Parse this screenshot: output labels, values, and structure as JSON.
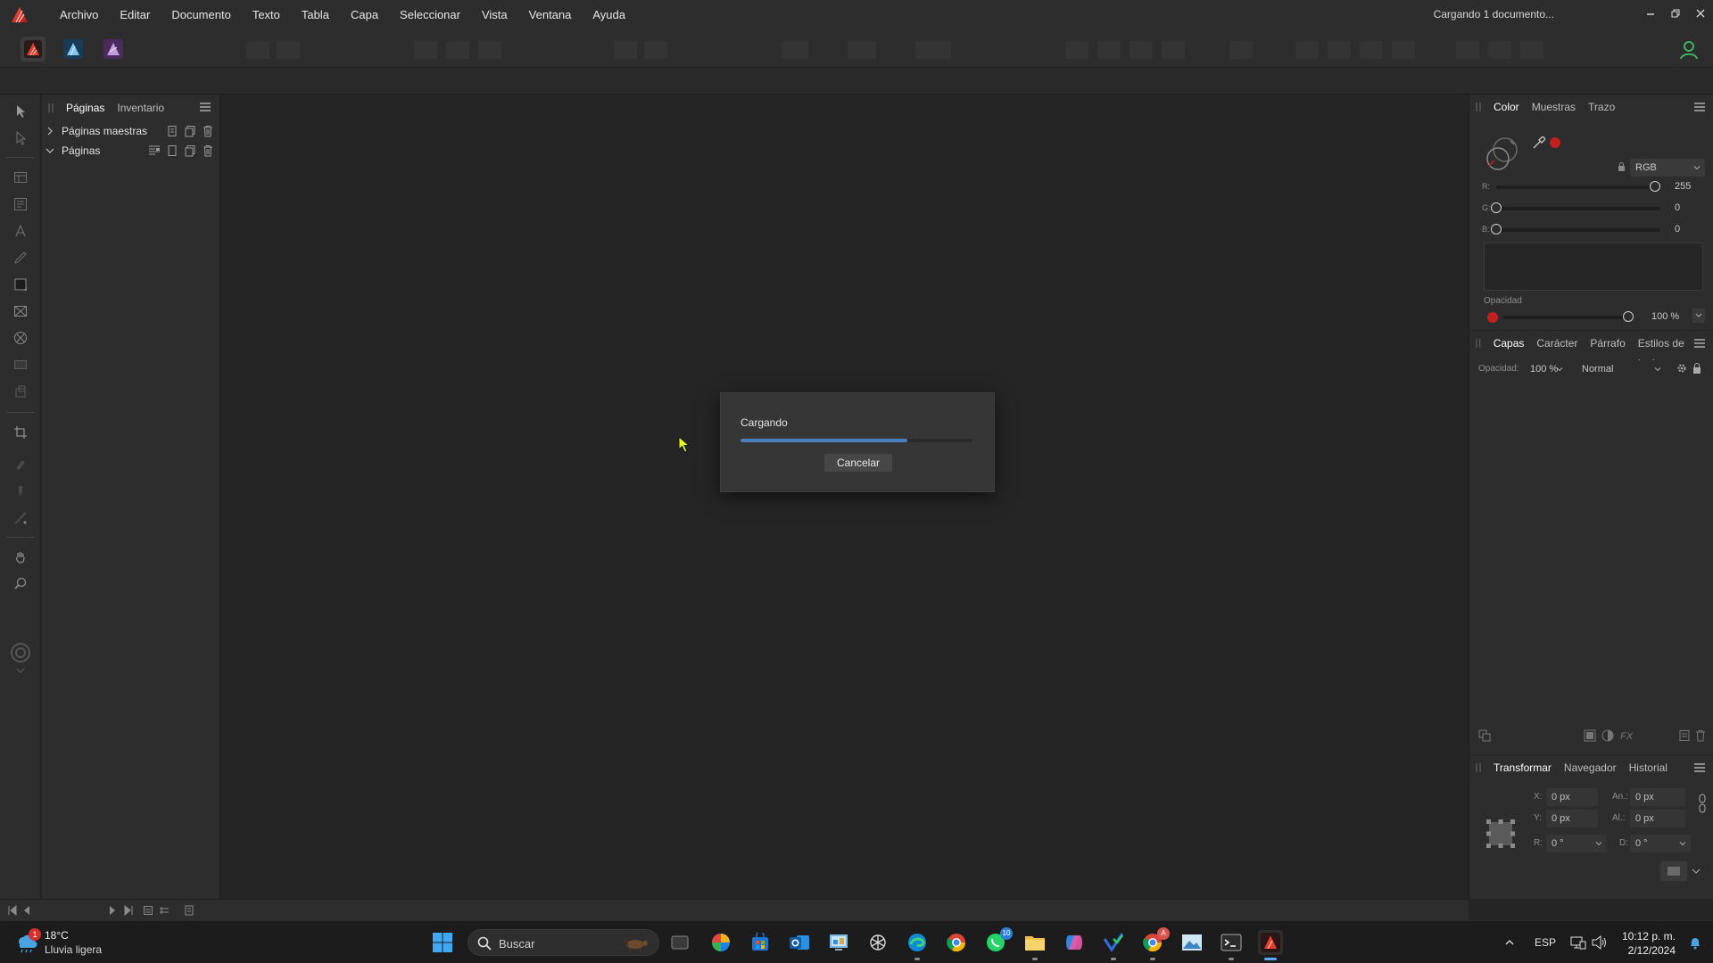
{
  "menu": {
    "items": [
      "Archivo",
      "Editar",
      "Documento",
      "Texto",
      "Tabla",
      "Capa",
      "Seleccionar",
      "Vista",
      "Ventana",
      "Ayuda"
    ],
    "status": "Cargando 1 documento..."
  },
  "pages_panel": {
    "tabs": [
      "Páginas",
      "Inventario"
    ],
    "rows": [
      "Páginas maestras",
      "Páginas"
    ]
  },
  "color_panel": {
    "tabs": [
      "Color",
      "Muestras",
      "Trazo"
    ],
    "mode": "RGB",
    "channels": [
      {
        "label": "R:",
        "value": "255",
        "level": 1.0
      },
      {
        "label": "G:",
        "value": "0",
        "level": 0.0
      },
      {
        "label": "B:",
        "value": "0",
        "level": 0.0
      }
    ],
    "opacity_label": "Opacidad",
    "opacity_value": "100 %",
    "opacity_level": 1.0,
    "accent": "#c21f1f"
  },
  "layers_panel": {
    "tabs": [
      "Capas",
      "Carácter",
      "Párrafo",
      "Estilos de texto"
    ],
    "opacity_label": "Opacidad:",
    "opacity_value": "100 %",
    "blend_mode": "Normal"
  },
  "transform_panel": {
    "tabs": [
      "Transformar",
      "Navegador",
      "Historial"
    ],
    "x_label": "X:",
    "x_value": "0 px",
    "y_label": "Y:",
    "y_value": "0 px",
    "w_label": "An.:",
    "w_value": "0 px",
    "h_label": "Al.:",
    "h_value": "0 px",
    "r_label": "R:",
    "r_value": "0 °",
    "s_label": "D:",
    "s_value": "0 °"
  },
  "dialog": {
    "title": "Cargando",
    "progress": 0.72,
    "cancel_label": "Cancelar",
    "progress_color": "#4b7fbd"
  },
  "taskbar": {
    "weather_temp": "18°C",
    "weather_desc": "Lluvia ligera",
    "weather_badge": "1",
    "search_placeholder": "Buscar",
    "whatsapp_badge": "10",
    "chrome_badge": "A",
    "language": "ESP",
    "time": "10:12 p. m.",
    "date": "2/12/2024"
  }
}
